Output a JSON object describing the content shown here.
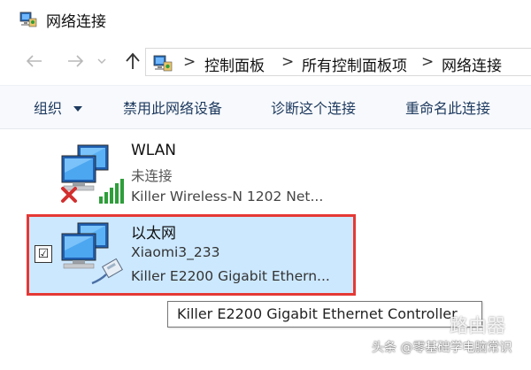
{
  "window": {
    "title": "网络连接",
    "icon": "network-connections-icon"
  },
  "nav": {
    "back_icon": "back-arrow-icon",
    "forward_icon": "forward-arrow-icon",
    "recent_icon": "chevron-down-icon",
    "up_icon": "up-arrow-icon"
  },
  "address": {
    "separator": ">",
    "crumbs": [
      "控制面板",
      "所有控制面板项",
      "网络连接"
    ]
  },
  "toolbar": {
    "organize": "组织",
    "disable": "禁用此网络设备",
    "diagnose": "诊断这个连接",
    "rename": "重命名此连接"
  },
  "connections": [
    {
      "name": "WLAN",
      "status": "未连接",
      "device": "Killer Wireless-N 1202 Net...",
      "icon": "wireless-network-icon",
      "badge": "disconnected-x-icon"
    },
    {
      "name": "以太网",
      "status": "Xiaomi3_233",
      "device": "Killer E2200 Gigabit Ethern...",
      "icon": "ethernet-network-icon",
      "selected": true,
      "checkbox": "☑"
    }
  ],
  "tooltip": {
    "text": "Killer E2200 Gigabit Ethernet Controller"
  },
  "watermark": {
    "line1": "头条 @零基础学电脑常识",
    "line2": "路由器"
  },
  "colors": {
    "selection_bg": "#cce8ff",
    "highlight_border": "#e53935",
    "toolbar_bg": "#f7f9fc",
    "signal_green": "#2e9e3a",
    "error_red": "#d32f2f"
  }
}
